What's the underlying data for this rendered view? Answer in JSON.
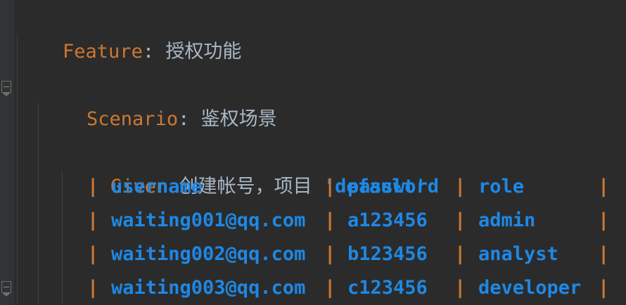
{
  "feature": {
    "keyword": "Feature",
    "colon": ":",
    "title": "授权功能"
  },
  "scenario": {
    "keyword": "Scenario",
    "colon": ":",
    "title": "鉴权场景"
  },
  "step": {
    "keyword": "Given",
    "text": "创建帐号，项目",
    "argument": "'default'"
  },
  "table": {
    "pipe": "|",
    "rows": [
      [
        "username",
        "password",
        "role"
      ],
      [
        "waiting001@qq.com",
        "a123456",
        "admin"
      ],
      [
        "waiting002@qq.com",
        "b123456",
        "analyst"
      ],
      [
        "waiting003@qq.com",
        "c123456",
        "developer"
      ]
    ]
  },
  "colors": {
    "background": "#2b2b2b",
    "keyword": "#cc7832",
    "text": "#a9b7c6",
    "table_value": "#1e88e5"
  }
}
